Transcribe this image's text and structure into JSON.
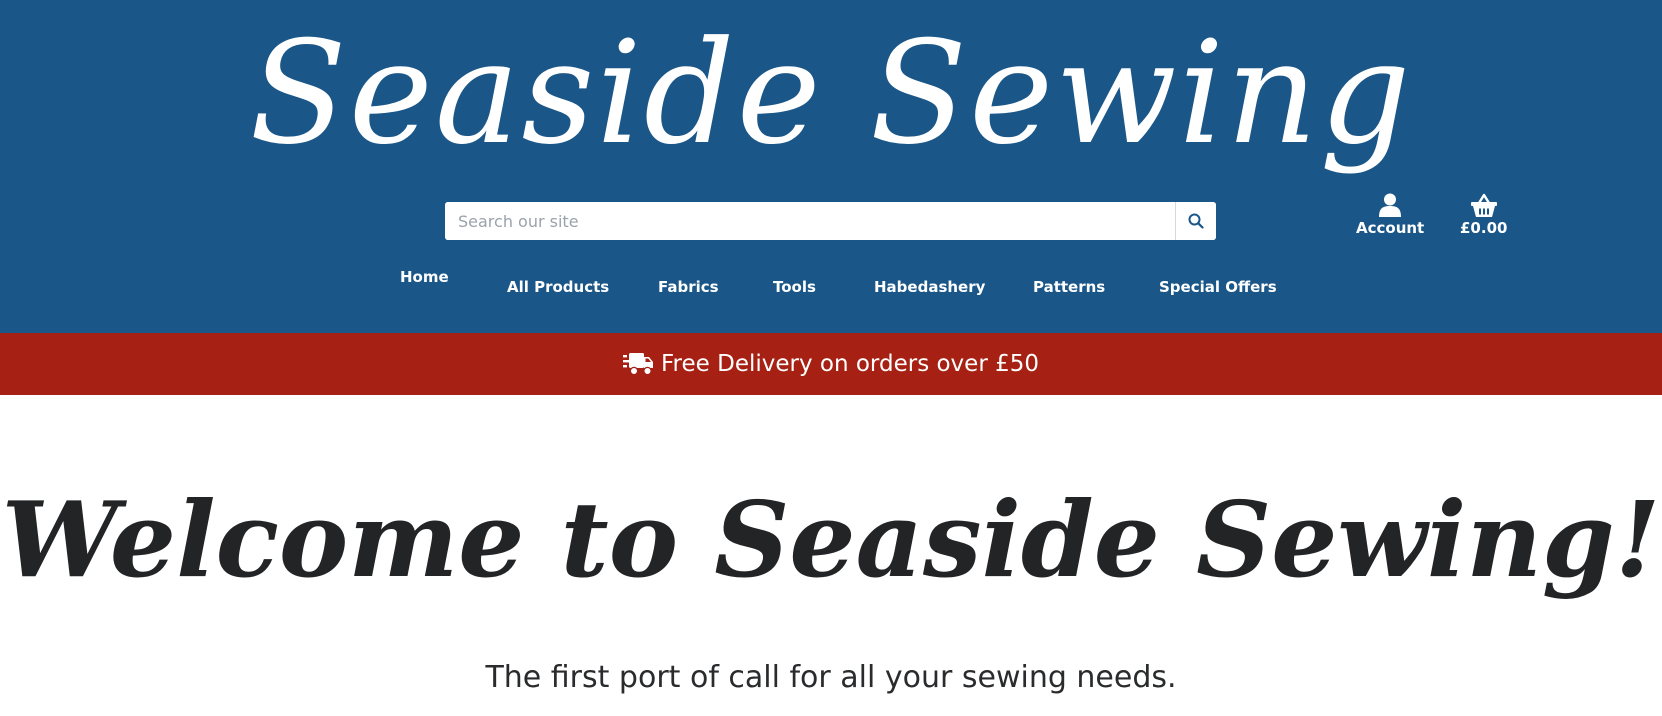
{
  "header": {
    "brand_title": "Seaside Sewing",
    "search": {
      "placeholder": "Search our site",
      "value": ""
    },
    "account_label": "Account",
    "basket_total": "£0.00"
  },
  "nav": {
    "items": [
      {
        "label": "Home"
      },
      {
        "label": "All Products"
      },
      {
        "label": "Fabrics"
      },
      {
        "label": "Tools"
      },
      {
        "label": "Habedashery"
      },
      {
        "label": "Patterns"
      },
      {
        "label": "Special Offers"
      }
    ]
  },
  "banner": {
    "text": "Free Delivery on orders over £50",
    "icon": "delivery-truck-icon"
  },
  "main": {
    "heading": "Welcome to Seaside Sewing!",
    "tagline": "The first port of call for all your sewing needs."
  },
  "colors": {
    "header_bg": "#1a5788",
    "banner_bg": "#a62114",
    "text_dark": "#232426"
  }
}
